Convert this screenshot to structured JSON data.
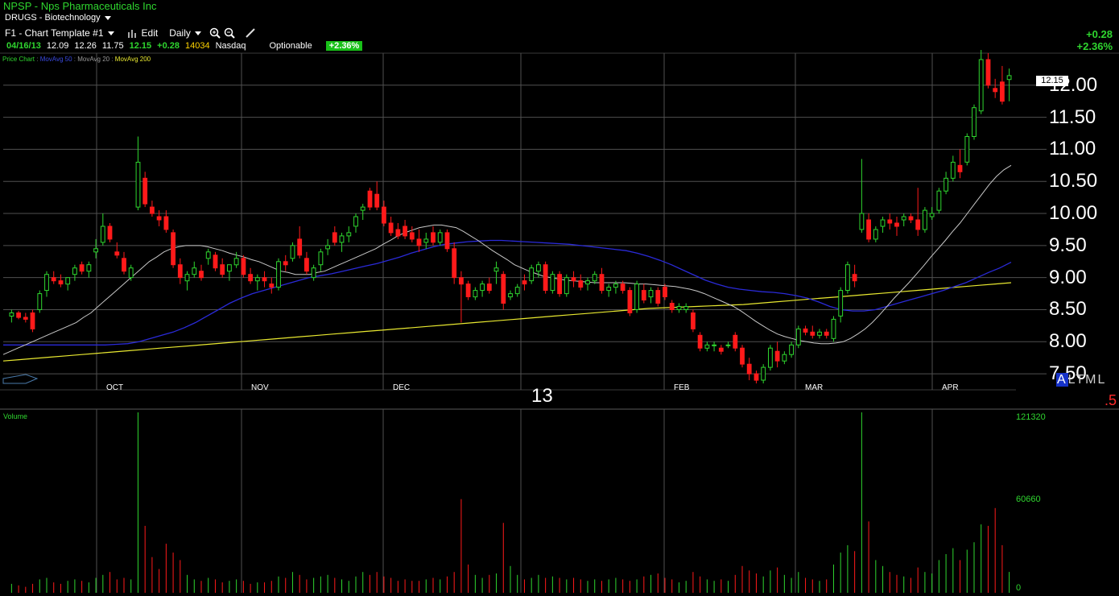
{
  "header": {
    "symbol_line": "NPSP - Nps Pharmaceuticals Inc",
    "sector": "DRUGS - Biotechnology",
    "template": "F1 - Chart Template #1",
    "edit_label": "Edit",
    "period": "Daily",
    "quote": {
      "date": "04/16/13",
      "open": "12.09",
      "high": "12.26",
      "low": "11.75",
      "close": "12.15",
      "change": "+0.28",
      "volume": "14034",
      "exchange": "Nasdaq",
      "optionable": "Optionable",
      "pct_badge": "+2.36%"
    },
    "legend": {
      "price": "Price Chart",
      "ma50": "MovAvg 50",
      "ma20": "MovAvg 20",
      "ma200": "MovAvg 200",
      "sep": " : "
    },
    "right_change": "+0.28",
    "right_pct": "+2.36%"
  },
  "price_axis": {
    "ticks": [
      "12.00",
      "11.50",
      "11.00",
      "10.50",
      "10.00",
      "9.50",
      "9.00",
      "8.50",
      "8.00",
      "7.50"
    ],
    "last_price": "12.15"
  },
  "months": [
    "OCT",
    "NOV",
    "DEC",
    "FEB",
    "MAR",
    "APR"
  ],
  "year_label": "13",
  "altml": {
    "first": "A",
    "rest": "LTML"
  },
  "ratio_label": ".5",
  "volume_panel": {
    "label": "Volume",
    "max_label": "121320",
    "mid_label": "60660",
    "zero_label": "0"
  },
  "colors": {
    "up": "#2fd62f",
    "down": "#ff1a1a",
    "ma20": "#c8c8c8",
    "ma50": "#2a2ad8",
    "ma200": "#e8e830",
    "grid": "#505050"
  },
  "chart_data": {
    "type": "candlestick",
    "ylim": [
      7.25,
      12.5
    ],
    "volume_max": 121320,
    "candles": [
      [
        8.4,
        8.5,
        8.3,
        8.45,
        6000
      ],
      [
        8.45,
        8.48,
        8.35,
        8.38,
        5000
      ],
      [
        8.38,
        8.45,
        8.3,
        8.35,
        4000
      ],
      [
        8.45,
        8.5,
        8.15,
        8.2,
        6000
      ],
      [
        8.5,
        8.8,
        8.45,
        8.75,
        9000
      ],
      [
        8.8,
        9.1,
        8.7,
        9.05,
        10000
      ],
      [
        9.0,
        9.1,
        8.9,
        8.95,
        7000
      ],
      [
        8.95,
        9.05,
        8.85,
        8.9,
        6000
      ],
      [
        8.9,
        9.0,
        8.8,
        9.0,
        8000
      ],
      [
        9.05,
        9.2,
        8.95,
        9.15,
        9000
      ],
      [
        9.2,
        9.25,
        9.05,
        9.1,
        8000
      ],
      [
        9.1,
        9.25,
        9.0,
        9.2,
        7000
      ],
      [
        9.4,
        9.6,
        9.3,
        9.45,
        10000
      ],
      [
        9.55,
        10.0,
        9.5,
        9.8,
        12000
      ],
      [
        9.8,
        9.85,
        9.55,
        9.6,
        14000
      ],
      [
        9.4,
        9.55,
        9.3,
        9.35,
        9000
      ],
      [
        9.3,
        9.4,
        9.05,
        9.1,
        10000
      ],
      [
        9.0,
        9.2,
        8.95,
        9.15,
        9000
      ],
      [
        10.1,
        11.2,
        10.05,
        10.8,
        121320
      ],
      [
        10.55,
        10.65,
        10.1,
        10.15,
        45000
      ],
      [
        10.1,
        10.2,
        9.95,
        10.0,
        24000
      ],
      [
        9.95,
        10.05,
        9.8,
        9.9,
        16000
      ],
      [
        9.95,
        10.05,
        9.7,
        9.75,
        33000
      ],
      [
        9.7,
        9.75,
        9.15,
        9.2,
        27000
      ],
      [
        9.2,
        9.3,
        8.9,
        9.0,
        22000
      ],
      [
        8.95,
        9.1,
        8.8,
        9.05,
        12000
      ],
      [
        9.05,
        9.25,
        9.0,
        9.15,
        9000
      ],
      [
        9.1,
        9.2,
        8.95,
        9.0,
        8000
      ],
      [
        9.3,
        9.45,
        9.2,
        9.4,
        10000
      ],
      [
        9.35,
        9.4,
        9.1,
        9.15,
        9000
      ],
      [
        9.2,
        9.3,
        9.0,
        9.05,
        7000
      ],
      [
        9.1,
        9.2,
        8.95,
        9.2,
        8000
      ],
      [
        9.2,
        9.4,
        9.15,
        9.3,
        9000
      ],
      [
        9.3,
        9.35,
        9.0,
        9.05,
        8000
      ],
      [
        9.05,
        9.15,
        8.9,
        8.95,
        6000
      ],
      [
        8.95,
        9.05,
        8.8,
        9.0,
        7000
      ],
      [
        9.0,
        9.1,
        8.85,
        8.95,
        7000
      ],
      [
        8.9,
        9.0,
        8.75,
        8.85,
        8000
      ],
      [
        8.85,
        9.3,
        8.8,
        9.25,
        11000
      ],
      [
        9.25,
        9.35,
        9.1,
        9.2,
        10000
      ],
      [
        9.3,
        9.55,
        9.25,
        9.5,
        14000
      ],
      [
        9.6,
        9.8,
        9.3,
        9.35,
        12000
      ],
      [
        9.3,
        9.4,
        9.05,
        9.1,
        9000
      ],
      [
        9.0,
        9.2,
        8.95,
        9.15,
        10000
      ],
      [
        9.2,
        9.45,
        9.1,
        9.4,
        11000
      ],
      [
        9.45,
        9.6,
        9.35,
        9.5,
        12000
      ],
      [
        9.7,
        9.8,
        9.5,
        9.55,
        10000
      ],
      [
        9.55,
        9.7,
        9.4,
        9.65,
        9000
      ],
      [
        9.65,
        9.8,
        9.55,
        9.7,
        8000
      ],
      [
        9.8,
        10.0,
        9.7,
        9.95,
        11000
      ],
      [
        10.05,
        10.15,
        9.9,
        10.1,
        14000
      ],
      [
        10.35,
        10.4,
        10.05,
        10.1,
        12000
      ],
      [
        10.3,
        10.5,
        10.05,
        10.1,
        14000
      ],
      [
        10.1,
        10.2,
        9.8,
        9.85,
        11000
      ],
      [
        9.85,
        9.95,
        9.65,
        9.7,
        10000
      ],
      [
        9.75,
        9.85,
        9.6,
        9.65,
        8000
      ],
      [
        9.8,
        9.9,
        9.6,
        9.65,
        9000
      ],
      [
        9.7,
        9.8,
        9.55,
        9.6,
        8000
      ],
      [
        9.6,
        9.75,
        9.4,
        9.5,
        8000
      ],
      [
        9.55,
        9.7,
        9.45,
        9.6,
        9000
      ],
      [
        9.7,
        9.8,
        9.5,
        9.55,
        10000
      ],
      [
        9.55,
        9.75,
        9.5,
        9.7,
        9000
      ],
      [
        9.7,
        9.75,
        9.4,
        9.45,
        11000
      ],
      [
        9.45,
        9.55,
        8.9,
        9.0,
        14000
      ],
      [
        9.0,
        9.1,
        8.3,
        8.9,
        63000
      ],
      [
        8.9,
        8.95,
        8.65,
        8.7,
        19000
      ],
      [
        8.7,
        8.85,
        8.65,
        8.8,
        12000
      ],
      [
        8.8,
        8.95,
        8.7,
        8.9,
        10000
      ],
      [
        8.9,
        9.0,
        8.75,
        8.8,
        12000
      ],
      [
        9.1,
        9.25,
        8.9,
        9.15,
        13000
      ],
      [
        9.05,
        9.1,
        8.5,
        8.6,
        47000
      ],
      [
        8.7,
        8.8,
        8.65,
        8.75,
        18000
      ],
      [
        8.75,
        8.9,
        8.7,
        8.85,
        12000
      ],
      [
        8.95,
        9.05,
        8.8,
        8.9,
        9000
      ],
      [
        8.95,
        9.2,
        8.9,
        9.15,
        10000
      ],
      [
        9.1,
        9.25,
        9.0,
        9.2,
        12000
      ],
      [
        9.2,
        9.25,
        8.75,
        8.8,
        10000
      ],
      [
        8.8,
        9.1,
        8.75,
        9.05,
        11000
      ],
      [
        9.05,
        9.1,
        8.7,
        8.75,
        10000
      ],
      [
        8.75,
        9.05,
        8.7,
        9.0,
        9000
      ],
      [
        9.0,
        9.1,
        8.85,
        8.95,
        10000
      ],
      [
        8.95,
        9.05,
        8.8,
        8.85,
        9000
      ],
      [
        8.9,
        9.0,
        8.8,
        8.95,
        8000
      ],
      [
        8.95,
        9.1,
        8.9,
        9.05,
        9000
      ],
      [
        9.05,
        9.15,
        8.75,
        8.8,
        8000
      ],
      [
        8.8,
        8.9,
        8.7,
        8.85,
        9000
      ],
      [
        8.85,
        8.95,
        8.75,
        8.9,
        10000
      ],
      [
        8.9,
        8.95,
        8.75,
        8.8,
        9000
      ],
      [
        8.8,
        8.85,
        8.4,
        8.45,
        8000
      ],
      [
        8.5,
        8.95,
        8.45,
        8.9,
        9000
      ],
      [
        8.8,
        8.9,
        8.6,
        8.65,
        11000
      ],
      [
        8.7,
        8.85,
        8.6,
        8.8,
        12000
      ],
      [
        8.8,
        8.85,
        8.55,
        8.6,
        13000
      ],
      [
        8.85,
        8.9,
        8.65,
        8.7,
        10000
      ],
      [
        8.6,
        8.65,
        8.45,
        8.5,
        9000
      ],
      [
        8.5,
        8.6,
        8.45,
        8.55,
        7000
      ],
      [
        8.5,
        8.6,
        8.45,
        8.55,
        8000
      ],
      [
        8.45,
        8.5,
        8.15,
        8.2,
        14000
      ],
      [
        8.1,
        8.15,
        7.85,
        7.9,
        11000
      ],
      [
        7.9,
        8.0,
        7.85,
        7.95,
        9000
      ],
      [
        7.95,
        8.0,
        7.85,
        7.95,
        8000
      ],
      [
        7.9,
        7.95,
        7.8,
        7.85,
        9000
      ],
      [
        7.95,
        8.0,
        7.9,
        7.95,
        8000
      ],
      [
        8.1,
        8.15,
        7.85,
        7.9,
        12000
      ],
      [
        7.9,
        7.95,
        7.6,
        7.65,
        18000
      ],
      [
        7.65,
        7.75,
        7.4,
        7.5,
        15000
      ],
      [
        7.5,
        7.55,
        7.35,
        7.4,
        13000
      ],
      [
        7.4,
        7.65,
        7.35,
        7.6,
        11000
      ],
      [
        7.6,
        7.95,
        7.55,
        7.9,
        15000
      ],
      [
        7.85,
        8.0,
        7.6,
        7.7,
        17000
      ],
      [
        7.7,
        7.85,
        7.65,
        7.8,
        12000
      ],
      [
        7.8,
        8.0,
        7.75,
        7.95,
        10000
      ],
      [
        7.95,
        8.25,
        7.9,
        8.2,
        14000
      ],
      [
        8.2,
        8.25,
        8.1,
        8.15,
        10000
      ],
      [
        8.15,
        8.25,
        8.05,
        8.1,
        9000
      ],
      [
        8.1,
        8.2,
        8.05,
        8.15,
        8000
      ],
      [
        8.15,
        8.2,
        8.05,
        8.1,
        9000
      ],
      [
        8.05,
        8.4,
        8.0,
        8.35,
        19000
      ],
      [
        8.4,
        8.85,
        8.3,
        8.8,
        27000
      ],
      [
        8.8,
        9.25,
        8.75,
        9.2,
        32000
      ],
      [
        9.05,
        9.2,
        8.85,
        8.95,
        28000
      ],
      [
        9.75,
        10.85,
        9.7,
        10.0,
        121320
      ],
      [
        9.9,
        10.0,
        9.55,
        9.6,
        48000
      ],
      [
        9.6,
        9.8,
        9.55,
        9.75,
        22000
      ],
      [
        9.8,
        9.95,
        9.7,
        9.9,
        18000
      ],
      [
        9.9,
        10.0,
        9.75,
        9.85,
        14000
      ],
      [
        9.85,
        9.95,
        9.65,
        9.8,
        12000
      ],
      [
        9.9,
        10.0,
        9.8,
        9.95,
        11000
      ],
      [
        9.95,
        10.0,
        9.85,
        9.9,
        10000
      ],
      [
        9.9,
        10.4,
        9.65,
        9.75,
        17000
      ],
      [
        9.75,
        10.1,
        9.7,
        10.05,
        14000
      ],
      [
        9.95,
        10.1,
        9.9,
        10.0,
        13000
      ],
      [
        10.05,
        10.4,
        10.0,
        10.35,
        22000
      ],
      [
        10.35,
        10.65,
        10.3,
        10.55,
        26000
      ],
      [
        10.55,
        10.9,
        10.5,
        10.8,
        30000
      ],
      [
        10.75,
        11.0,
        10.55,
        10.65,
        22000
      ],
      [
        10.8,
        11.25,
        10.75,
        11.2,
        29000
      ],
      [
        11.2,
        11.7,
        11.15,
        11.65,
        34000
      ],
      [
        11.6,
        12.55,
        11.55,
        12.4,
        46000
      ],
      [
        12.4,
        12.5,
        11.95,
        12.0,
        45000
      ],
      [
        11.95,
        12.1,
        11.8,
        11.9,
        57000
      ],
      [
        12.05,
        12.3,
        11.7,
        11.75,
        32000
      ],
      [
        12.09,
        12.26,
        11.75,
        12.15,
        14034
      ]
    ],
    "ma20": [
      7.8,
      7.85,
      7.9,
      7.95,
      8.0,
      8.05,
      8.1,
      8.15,
      8.2,
      8.25,
      8.3,
      8.38,
      8.45,
      8.55,
      8.65,
      8.75,
      8.85,
      8.95,
      9.05,
      9.15,
      9.25,
      9.32,
      9.4,
      9.45,
      9.48,
      9.5,
      9.5,
      9.5,
      9.48,
      9.45,
      9.42,
      9.38,
      9.35,
      9.32,
      9.28,
      9.25,
      9.2,
      9.15,
      9.1,
      9.08,
      9.05,
      9.05,
      9.05,
      9.08,
      9.1,
      9.15,
      9.2,
      9.25,
      9.3,
      9.35,
      9.4,
      9.45,
      9.52,
      9.58,
      9.65,
      9.7,
      9.74,
      9.78,
      9.8,
      9.82,
      9.82,
      9.8,
      9.78,
      9.72,
      9.65,
      9.58,
      9.5,
      9.42,
      9.35,
      9.28,
      9.2,
      9.15,
      9.1,
      9.06,
      9.02,
      9.0,
      8.98,
      8.96,
      8.95,
      8.94,
      8.93,
      8.92,
      8.92,
      8.92,
      8.92,
      8.92,
      8.91,
      8.9,
      8.9,
      8.89,
      8.88,
      8.87,
      8.86,
      8.84,
      8.82,
      8.79,
      8.75,
      8.7,
      8.65,
      8.6,
      8.55,
      8.48,
      8.4,
      8.32,
      8.25,
      8.18,
      8.12,
      8.08,
      8.05,
      8.02,
      8.0,
      7.98,
      7.97,
      7.97,
      7.98,
      8.0,
      8.05,
      8.12,
      8.2,
      8.3,
      8.42,
      8.55,
      8.68,
      8.8,
      8.92,
      9.05,
      9.18,
      9.32,
      9.45,
      9.58,
      9.72,
      9.85,
      10.0,
      10.15,
      10.3,
      10.45,
      10.58,
      10.68,
      10.75
    ],
    "ma50": [
      7.95,
      7.95,
      7.95,
      7.95,
      7.95,
      7.95,
      7.95,
      7.95,
      7.95,
      7.95,
      7.96,
      7.97,
      8.0,
      8.05,
      8.1,
      8.15,
      8.22,
      8.3,
      8.4,
      8.5,
      8.6,
      8.68,
      8.75,
      8.8,
      8.85,
      8.9,
      8.95,
      9.0,
      9.03,
      9.06,
      9.1,
      9.14,
      9.18,
      9.22,
      9.27,
      9.32,
      9.38,
      9.43,
      9.48,
      9.52,
      9.54,
      9.56,
      9.57,
      9.58,
      9.58,
      9.57,
      9.56,
      9.55,
      9.54,
      9.53,
      9.52,
      9.5,
      9.48,
      9.46,
      9.44,
      9.42,
      9.38,
      9.33,
      9.27,
      9.2,
      9.12,
      9.04,
      8.96,
      8.9,
      8.85,
      8.82,
      8.8,
      8.78,
      8.77,
      8.75,
      8.72,
      8.68,
      8.62,
      8.55,
      8.5,
      8.48,
      8.48,
      8.5,
      8.55,
      8.6,
      8.65,
      8.7,
      8.75,
      8.8,
      8.86,
      8.92,
      9.0,
      9.08,
      9.15,
      9.24
    ],
    "ma200": [
      7.7,
      7.72,
      7.74,
      7.76,
      7.78,
      7.8,
      7.82,
      7.84,
      7.86,
      7.88,
      7.9,
      7.92,
      7.94,
      7.96,
      7.98,
      8.0,
      8.02,
      8.04,
      8.06,
      8.08,
      8.1,
      8.12,
      8.14,
      8.16,
      8.18,
      8.2,
      8.22,
      8.24,
      8.26,
      8.28,
      8.3,
      8.32,
      8.34,
      8.36,
      8.38,
      8.4,
      8.42,
      8.44,
      8.46,
      8.48,
      8.5,
      8.52,
      8.53,
      8.54,
      8.55,
      8.56,
      8.57,
      8.58,
      8.6,
      8.62,
      8.64,
      8.66,
      8.68,
      8.7,
      8.72,
      8.74,
      8.76,
      8.78,
      8.8,
      8.82,
      8.84,
      8.86,
      8.88,
      8.9,
      8.92
    ]
  }
}
